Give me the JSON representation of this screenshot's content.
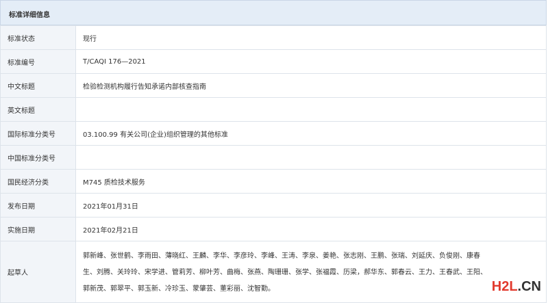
{
  "header": {
    "title": "标准详细信息"
  },
  "rows": [
    {
      "label": "标准状态",
      "value": "现行"
    },
    {
      "label": "标准编号",
      "value": "T/CAQI 176—2021"
    },
    {
      "label": "中文标题",
      "value": "检验检测机构履行告知承诺内部核查指南"
    },
    {
      "label": "英文标题",
      "value": ""
    },
    {
      "label": "国际标准分类号",
      "value": "03.100.99 有关公司(企业)组织管理的其他标准"
    },
    {
      "label": "中国标准分类号",
      "value": ""
    },
    {
      "label": "国民经济分类",
      "value": "M745 质检技术服务"
    },
    {
      "label": "发布日期",
      "value": "2021年01月31日"
    },
    {
      "label": "实施日期",
      "value": "2021年02月21日"
    }
  ],
  "drafters": {
    "label": "起草人",
    "lines": [
      "郭新峰、张世鹤、李雨田、薄晓红、王麟、李华、李彦玲、李峰、王涛、李泉、姜艳、张志刚、王鹏、张瑞、刘延庆、负俊刚、康春",
      "生、刘腾、关玲玲、宋学进、管莉芳、柳叶芳、曲梅、张燕、陶珊珊、张学、张福霞、历梁，郝华东、郭春云、王力、王春武、王阳、",
      "郭新茂、郭翠平、郭玉新、冷珍玉、蒙肇芸、董彩丽、沈智勤。"
    ]
  },
  "watermark": {
    "part1": "H2L",
    "part2": ".CN"
  },
  "colors": {
    "title_bg": "#e4edf7",
    "label_bg": "#f2f5f9",
    "border": "#dde3ea",
    "watermark_red": "#e23a2e"
  }
}
